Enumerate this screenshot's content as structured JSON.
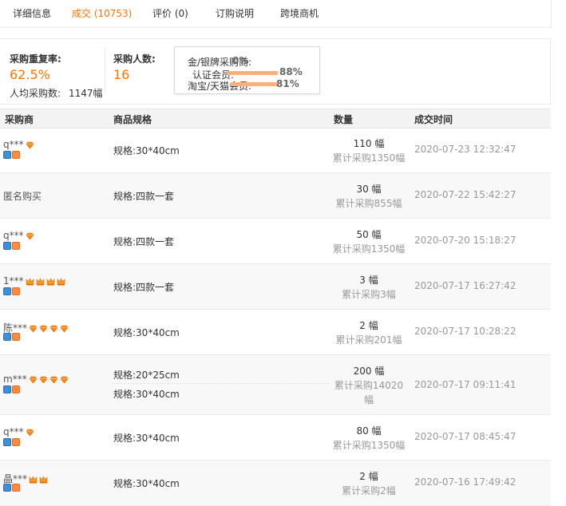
{
  "tabs": [
    {
      "label": "详细信息"
    },
    {
      "label": "成交 (10753)",
      "active": true
    },
    {
      "label": "评价 (0)"
    },
    {
      "label": "订购说明"
    },
    {
      "label": "跨境商机"
    }
  ],
  "summary": {
    "repeat_rate_label": "采购重复率:",
    "repeat_rate_value": "62.5%",
    "avg_label": "人均采购数:",
    "avg_value": "1147幅",
    "buyers_label": "采购人数:",
    "buyers_value": "16"
  },
  "popup": {
    "items": [
      {
        "label": "金/银牌采购商:",
        "pct": "0%",
        "value": 0
      },
      {
        "label": "认证会员:",
        "pct": "88%",
        "value": 0.88
      },
      {
        "label": "淘宝/天猫会员:",
        "pct": "81%",
        "value": 0.81
      }
    ]
  },
  "table": {
    "headers": {
      "buyer": "采购商",
      "spec": "商品规格",
      "qty": "数量",
      "time": "成交时间"
    },
    "rows": [
      {
        "buyer": "q***",
        "rank": "diamond",
        "rank_count": 1,
        "specs": [
          "规格:30*40cm"
        ],
        "qty": "110 幅",
        "cum": "累计采购1350幅",
        "time": "2020-07-23 12:32:47",
        "badges": true
      },
      {
        "buyer": "匿名购买",
        "rank": "none",
        "rank_count": 0,
        "specs": [
          "规格:四款一套"
        ],
        "qty": "30 幅",
        "cum": "累计采购855幅",
        "time": "2020-07-22 15:42:27",
        "badges": false
      },
      {
        "buyer": "q***",
        "rank": "diamond",
        "rank_count": 1,
        "specs": [
          "规格:四款一套"
        ],
        "qty": "50 幅",
        "cum": "累计采购1350幅",
        "time": "2020-07-20 15:18:27",
        "badges": true
      },
      {
        "buyer": "1***",
        "rank": "crown",
        "rank_count": 4,
        "specs": [
          "规格:四款一套"
        ],
        "qty": "3 幅",
        "cum": "累计采购3幅",
        "time": "2020-07-17 16:27:42",
        "badges": true
      },
      {
        "buyer": "陈***",
        "rank": "diamond",
        "rank_count": 4,
        "specs": [
          "规格:30*40cm"
        ],
        "qty": "2 幅",
        "cum": "累计采购201幅",
        "time": "2020-07-17 10:28:22",
        "badges": true
      },
      {
        "buyer": "m***",
        "rank": "diamond",
        "rank_count": 4,
        "specs": [
          "规格:20*25cm",
          "规格:30*40cm"
        ],
        "qty": "200 幅",
        "cum": "累计采购14020",
        "cum2": "幅",
        "time": "2020-07-17 09:11:41",
        "badges": true
      },
      {
        "buyer": "q***",
        "rank": "diamond",
        "rank_count": 1,
        "specs": [
          "规格:30*40cm"
        ],
        "qty": "80 幅",
        "cum": "累计采购1350幅",
        "time": "2020-07-17 08:45:47",
        "badges": true
      },
      {
        "buyer": "晶***",
        "rank": "crown",
        "rank_count": 2,
        "specs": [
          "规格:30*40cm"
        ],
        "qty": "2 幅",
        "cum": "累计采购2幅",
        "time": "2020-07-16 17:49:42",
        "badges": true
      }
    ]
  },
  "colors": {
    "accent": "#ff7300",
    "bar": "#ffb07a"
  }
}
